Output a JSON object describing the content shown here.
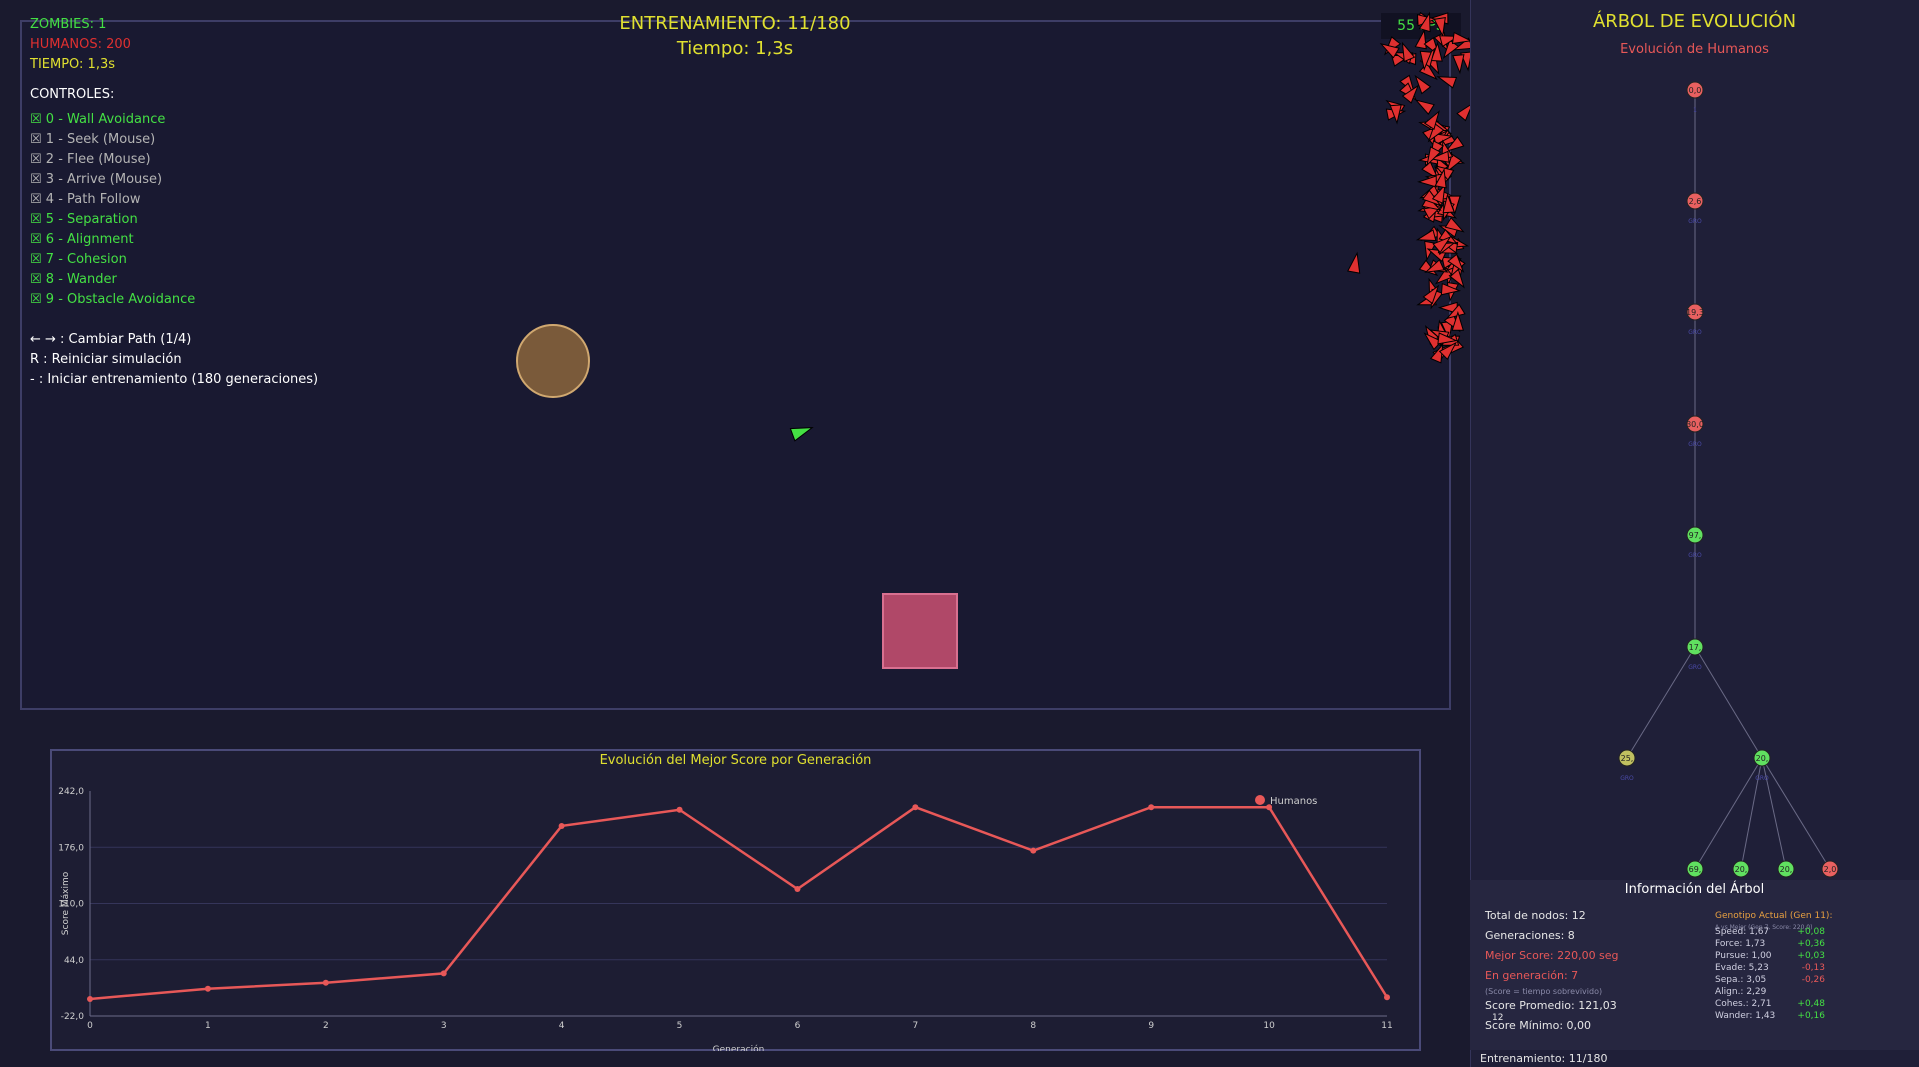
{
  "hud": {
    "zombies": "ZOMBIES: 1",
    "humanos": "HUMANOS: 200",
    "tiempo": "TIEMPO: 1,3s",
    "fps": "55 FPS",
    "training_title": "ENTRENAMIENTO: 11/180",
    "training_time": "Tiempo: 1,3s"
  },
  "controls": {
    "heading": "CONTROLES:",
    "items": [
      {
        "label": "☒ 0 - Wall Avoidance",
        "active": true
      },
      {
        "label": "☒ 1 - Seek (Mouse)",
        "active": false
      },
      {
        "label": "☒ 2 - Flee (Mouse)",
        "active": false
      },
      {
        "label": "☒ 3 - Arrive (Mouse)",
        "active": false
      },
      {
        "label": "☒ 4 - Path Follow",
        "active": false
      },
      {
        "label": "☒ 5 - Separation",
        "active": true
      },
      {
        "label": "☒ 6 - Alignment",
        "active": true
      },
      {
        "label": "☒ 7 - Cohesion",
        "active": true
      },
      {
        "label": "☒ 8 - Wander",
        "active": true
      },
      {
        "label": "☒ 9 - Obstacle Avoidance",
        "active": true
      }
    ],
    "extra": [
      "← → : Cambiar Path (1/4)",
      "R : Reiniciar simulación",
      "- : Iniciar entrenamiento (180 generaciones)"
    ]
  },
  "colors": {
    "active": "#44e044",
    "inactive": "#b4b4b4",
    "zombie": "#44e044",
    "human": "#e03030",
    "accent": "#e0e030",
    "chart_line": "#e85858"
  },
  "chart_data": {
    "type": "line",
    "title": "Evolución del Mejor Score por Generación",
    "xlabel": "Generación",
    "ylabel": "Score Máximo",
    "ylim": [
      -22,
      242
    ],
    "yticks": [
      "242,0",
      "176,0",
      "110,0",
      "44,0",
      "-22,0"
    ],
    "x": [
      0,
      1,
      2,
      3,
      4,
      5,
      6,
      7,
      8,
      9,
      10,
      11
    ],
    "series": [
      {
        "name": "Humanos",
        "values": [
          -2,
          10,
          17,
          28,
          201,
          220,
          127,
          223,
          172,
          223,
          223,
          0
        ]
      }
    ],
    "legend": "top-right",
    "grid": true
  },
  "tree": {
    "title": "ÁRBOL DE EVOLUCIÓN",
    "subtitle": "Evolución de Humanos",
    "nodes": [
      {
        "label": "0,0",
        "color": "#e86060",
        "tag": "1"
      },
      {
        "label": "2,6",
        "color": "#e86060",
        "tag": "GRO"
      },
      {
        "label": "19,3",
        "color": "#e86060",
        "tag": "GRO"
      },
      {
        "label": "30,0",
        "color": "#e86060",
        "tag": "GRO"
      },
      {
        "label": "97,",
        "color": "#60e060",
        "tag": "GRO"
      },
      {
        "label": "17,",
        "color": "#60e060",
        "tag": "GRO"
      },
      {
        "label": "25,",
        "color": "#c0c060",
        "tag": "GRO"
      },
      {
        "label": "20,",
        "color": "#60e060",
        "tag": "GRO"
      },
      {
        "label": "69,",
        "color": "#60e060",
        "tag": ""
      },
      {
        "label": "20,",
        "color": "#60e060",
        "tag": ""
      },
      {
        "label": "20,",
        "color": "#60e060",
        "tag": ""
      },
      {
        "label": "2,0",
        "color": "#e86060",
        "tag": ""
      }
    ]
  },
  "info": {
    "title": "Información del Árbol",
    "total_nodes": "Total de nodos: 12",
    "generations": "Generaciones: 8",
    "best_score": "Mejor Score: 220,00 seg",
    "in_generation": "En generación: 7",
    "note": "(Score = tiempo sobrevivido)",
    "avg_score": "Score Promedio: 121,03",
    "min_score": "Score Mínimo: 0,00",
    "row_marker": "12",
    "genotype_title": "Genotipo Actual (Gen 11):",
    "genotype_sub": "Δ vs Mejor (Gen 7, Score: 220,0)",
    "genes": [
      {
        "name": "Speed: 1,67",
        "delta": "+0,08"
      },
      {
        "name": "Force: 1,73",
        "delta": "+0,36"
      },
      {
        "name": "Pursue: 1,00",
        "delta": "+0,03"
      },
      {
        "name": "Evade: 5,23",
        "delta": "-0,13"
      },
      {
        "name": "Sepa.: 3,05",
        "delta": "-0,26"
      },
      {
        "name": "Align.: 2,29",
        "delta": ""
      },
      {
        "name": "Cohes.: 2,71",
        "delta": "+0,48"
      },
      {
        "name": "Wander: 1,43",
        "delta": "+0,16"
      }
    ],
    "footer": "Entrenamiento: 11/180"
  }
}
